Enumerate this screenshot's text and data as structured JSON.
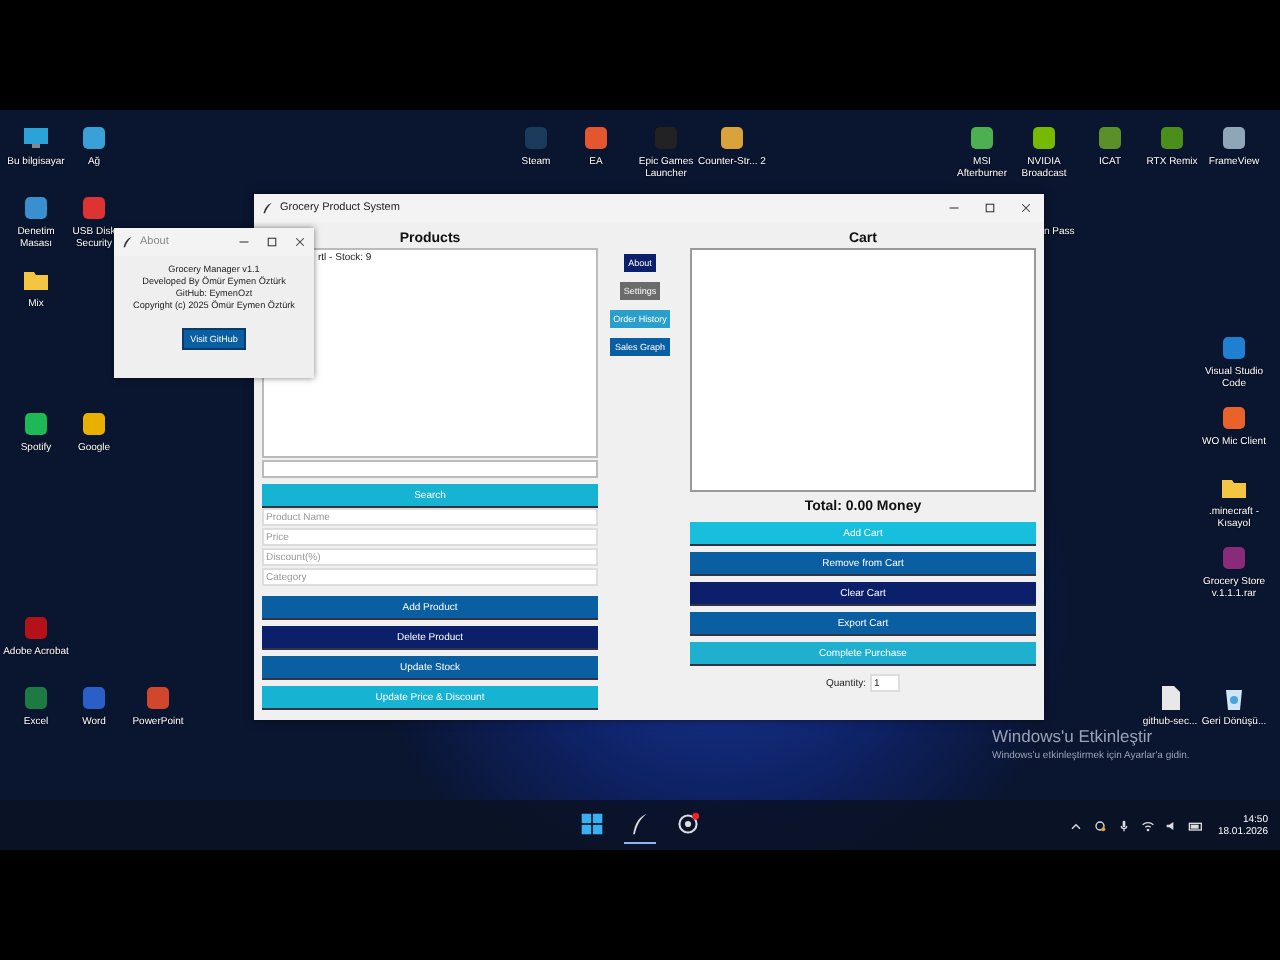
{
  "desktop_icons": [
    {
      "label": "Bu bilgisayar",
      "kind": "monitor"
    },
    {
      "label": "Ağ",
      "kind": "network"
    },
    {
      "label": "Denetim Masası",
      "kind": "panel"
    },
    {
      "label": "USB Disk Security",
      "kind": "shield"
    },
    {
      "label": "Mix",
      "kind": "folder"
    },
    {
      "label": "Spotify",
      "kind": "spotify"
    },
    {
      "label": "Google",
      "kind": "chrome"
    },
    {
      "label": "Adobe Acrobat",
      "kind": "pdf"
    },
    {
      "label": "Excel",
      "kind": "excel"
    },
    {
      "label": "Word",
      "kind": "word"
    },
    {
      "label": "PowerPoint",
      "kind": "powerpoint"
    },
    {
      "label": "Steam",
      "kind": "steam"
    },
    {
      "label": "EA",
      "kind": "ea"
    },
    {
      "label": "Epic Games Launcher",
      "kind": "epic"
    },
    {
      "label": "Counter-Str... 2",
      "kind": "cs"
    },
    {
      "label": "MSI Afterburner",
      "kind": "msi"
    },
    {
      "label": "NVIDIA Broadcast",
      "kind": "nvidia"
    },
    {
      "label": "ICAT",
      "kind": "icat"
    },
    {
      "label": "RTX Remix",
      "kind": "remix"
    },
    {
      "label": "FrameView",
      "kind": "frameview"
    },
    {
      "label": "Visual Studio Code",
      "kind": "vscode"
    },
    {
      "label": "WO Mic Client",
      "kind": "mic"
    },
    {
      "label": ".minecraft - Kısayol",
      "kind": "folder"
    },
    {
      "label": "Grocery Store v.1.1.1.rar",
      "kind": "rar"
    },
    {
      "label": "github-sec...",
      "kind": "file"
    },
    {
      "label": "Geri Dönüşü...",
      "kind": "recycle"
    }
  ],
  "partial_icon_label": "n Pass",
  "main_window": {
    "title": "Grocery Product System",
    "products": {
      "heading": "Products",
      "items": [
        "rtl - Stock: 9"
      ],
      "search_button": "Search",
      "fields": [
        {
          "placeholder": "Product Name"
        },
        {
          "placeholder": "Price"
        },
        {
          "placeholder": "Discount(%)"
        },
        {
          "placeholder": "Category"
        }
      ],
      "buttons": [
        {
          "label": "Add Product",
          "color": "#0a5fa3"
        },
        {
          "label": "Delete Product",
          "color": "#0b1f6b"
        },
        {
          "label": "Update Stock",
          "color": "#0a5fa3"
        },
        {
          "label": "Update Price & Discount",
          "color": "#17b3d3"
        }
      ]
    },
    "menu_buttons": [
      {
        "label": "About",
        "color": "#0b1f6b"
      },
      {
        "label": "Settings",
        "color": "#6b6b6b"
      },
      {
        "label": "Order History",
        "color": "#2b9fcc"
      },
      {
        "label": "Sales Graph",
        "color": "#0a5fa3"
      }
    ],
    "cart": {
      "heading": "Cart",
      "total": "Total: 0.00 Money",
      "buttons": [
        {
          "label": "Add Cart",
          "color": "#17bfdc"
        },
        {
          "label": "Remove from Cart",
          "color": "#0a5fa3"
        },
        {
          "label": "Clear Cart",
          "color": "#0b1f6b"
        },
        {
          "label": "Export Cart",
          "color": "#0a5fa3"
        },
        {
          "label": "Complete Purchase",
          "color": "#1fb0d0"
        }
      ],
      "quantity_label": "Quantity:",
      "quantity_value": "1"
    }
  },
  "about_window": {
    "title": "About",
    "lines": [
      "Grocery Manager v1.1",
      "Developed By Ömür Eymen Öztürk",
      "GitHub: EymenOzt",
      "Copyright (c) 2025 Ömür Eymen Öztürk"
    ],
    "button": "Visit GitHub"
  },
  "activation": {
    "title": "Windows'u Etkinleştir",
    "text": "Windows'u etkinleştirmek için Ayarlar'a gidin."
  },
  "taskbar": {
    "apps": [
      {
        "kind": "start",
        "running": false
      },
      {
        "kind": "feather",
        "running": true
      },
      {
        "kind": "chrome",
        "running": false
      }
    ],
    "time": "14:50",
    "date": "18.01.2026"
  }
}
